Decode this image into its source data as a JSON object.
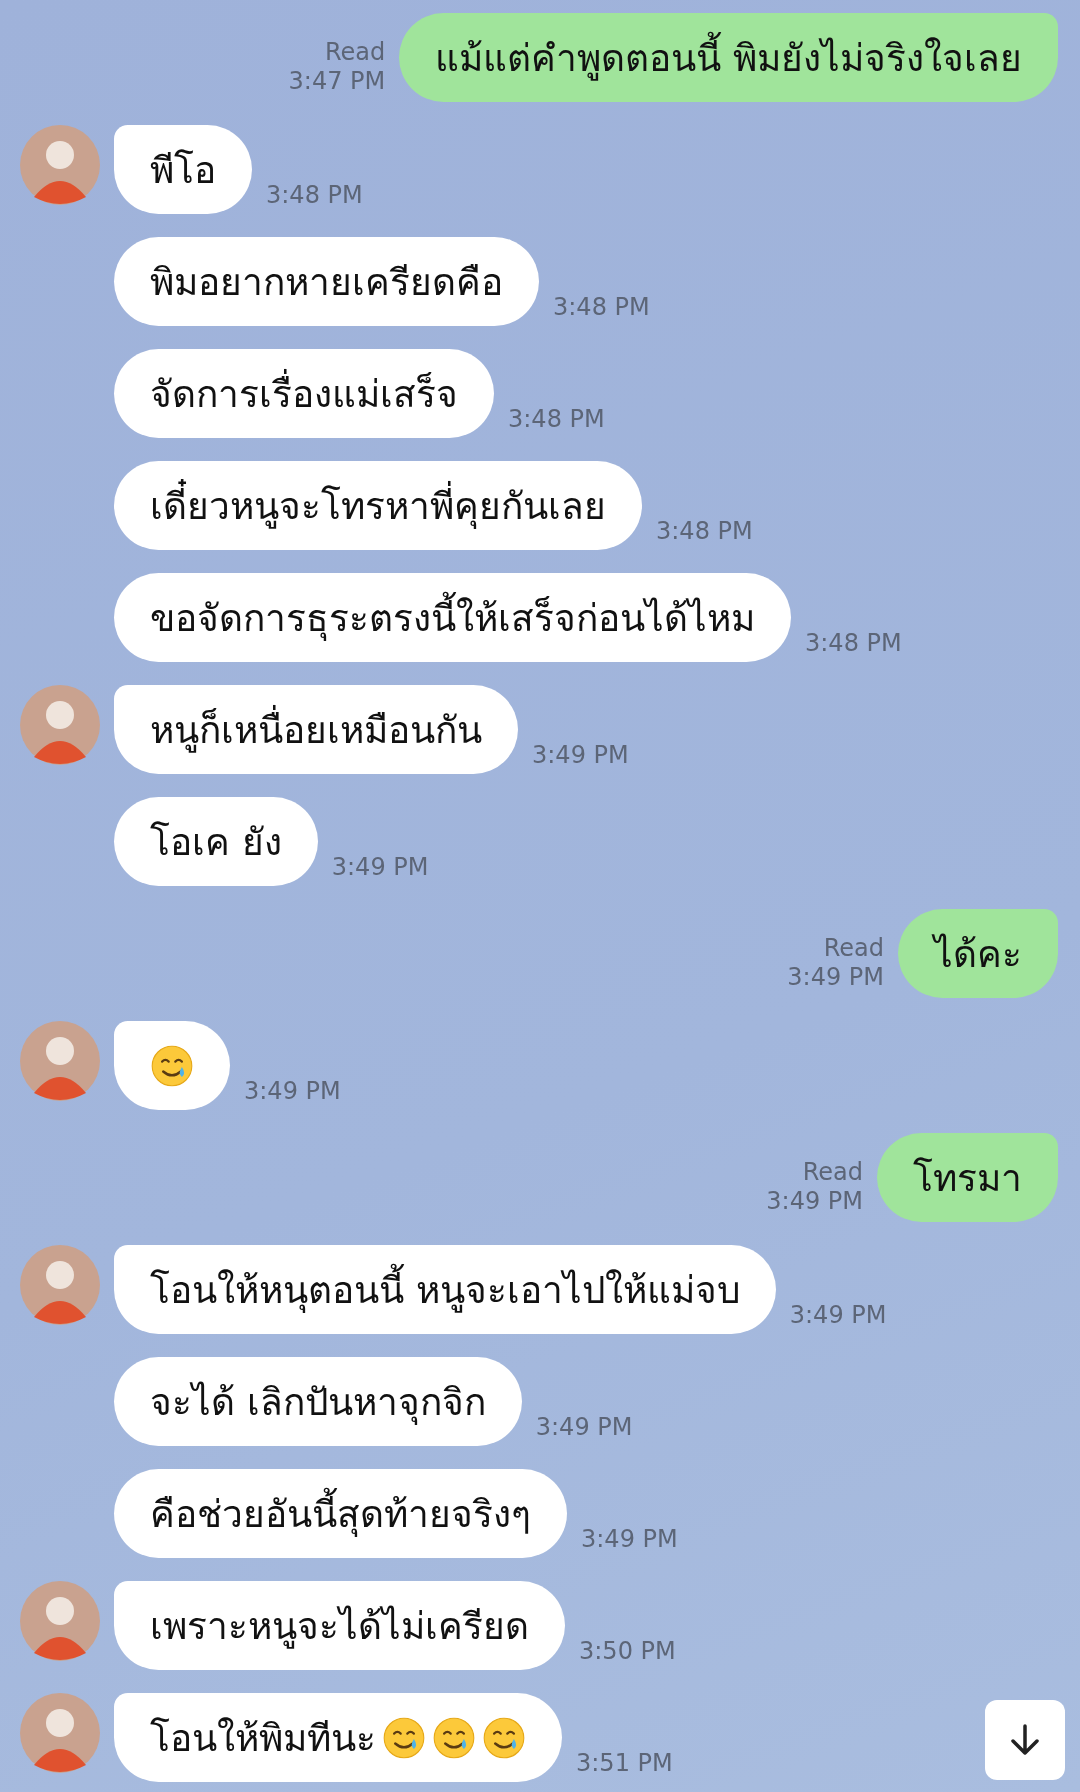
{
  "messages": [
    {
      "kind": "sent",
      "text": "แม้แต่คำพูดตอนนี้ พิมยังไม่จริงใจเลย",
      "status": "Read",
      "time": "3:47 PM"
    },
    {
      "kind": "received",
      "show_avatar": true,
      "text": "พีโอ",
      "time": "3:48 PM"
    },
    {
      "kind": "received",
      "show_avatar": false,
      "text": "พิมอยากหายเครียดคือ",
      "time": "3:48 PM"
    },
    {
      "kind": "received",
      "show_avatar": false,
      "text": "จัดการเรื่องแม่เสร็จ",
      "time": "3:48 PM"
    },
    {
      "kind": "received",
      "show_avatar": false,
      "text": "เดี๋ยวหนูจะโทรหาพี่คุยกันเลย",
      "time": "3:48 PM"
    },
    {
      "kind": "received",
      "show_avatar": false,
      "text": "ขอจัดการธุระตรงนี้ให้เสร็จก่อนได้ไหม",
      "time": "3:48 PM"
    },
    {
      "kind": "received",
      "show_avatar": true,
      "text": "หนูก็เหนื่อยเหมือนกัน",
      "time": "3:49 PM"
    },
    {
      "kind": "received",
      "show_avatar": false,
      "text": "โอเค ยัง",
      "time": "3:49 PM"
    },
    {
      "kind": "sent",
      "text": "ได้คะ",
      "status": "Read",
      "time": "3:49 PM"
    },
    {
      "kind": "received",
      "show_avatar": true,
      "emojis": [
        {
          "kind": "smiling-tear"
        }
      ],
      "time": "3:49 PM"
    },
    {
      "kind": "sent",
      "text": "โทรมา",
      "status": "Read",
      "time": "3:49 PM"
    },
    {
      "kind": "received",
      "show_avatar": true,
      "text": "โอนให้หนุตอนนี้ หนูจะเอาไปให้แม่จบ",
      "time": "3:49 PM"
    },
    {
      "kind": "received",
      "show_avatar": false,
      "text": "จะได้ เลิกปันหาจุกจิก",
      "time": "3:49 PM"
    },
    {
      "kind": "received",
      "show_avatar": false,
      "text": "คือช่วยอันนี้สุดท้ายจริงๆ",
      "time": "3:49 PM"
    },
    {
      "kind": "received",
      "show_avatar": true,
      "text": "เพราะหนูจะได้ไม่เครียด",
      "time": "3:50 PM"
    },
    {
      "kind": "received",
      "show_avatar": true,
      "text": "โอนให้พิมทีนะ",
      "emojis": [
        {
          "kind": "smiling-tear"
        },
        {
          "kind": "smiling-tear"
        },
        {
          "kind": "smiling-tear"
        }
      ],
      "time": "3:51 PM"
    }
  ]
}
